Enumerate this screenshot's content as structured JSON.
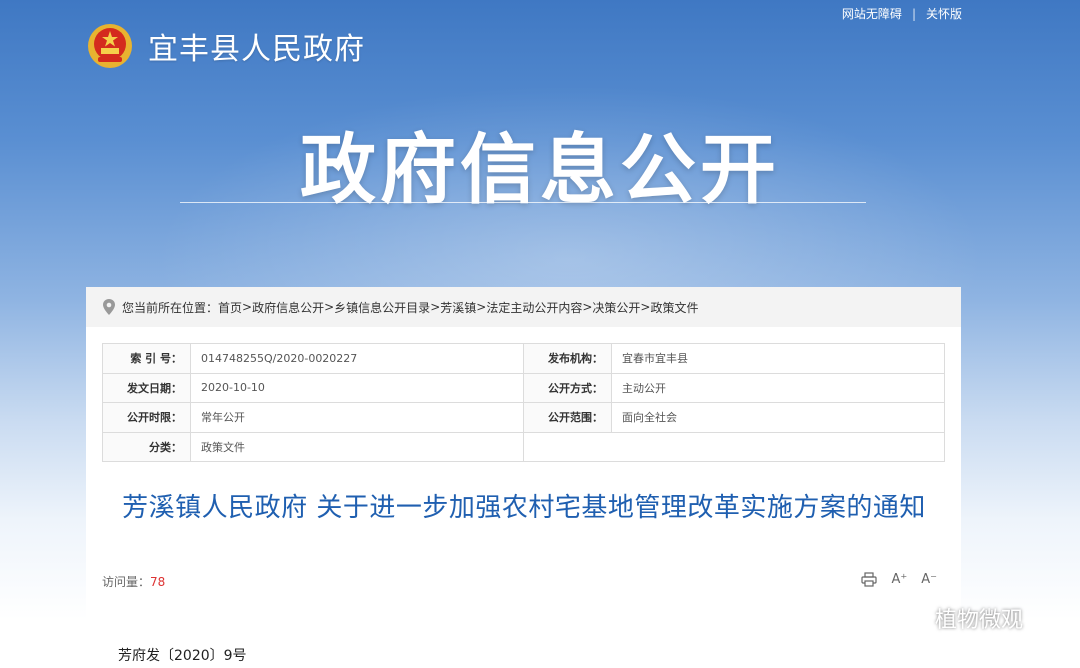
{
  "topbar": {
    "accessibility": "网站无障碍",
    "care": "关怀版",
    "separator": "|"
  },
  "site": {
    "title": "宜丰县人民政府"
  },
  "hero": {
    "title": "政府信息公开"
  },
  "breadcrumb": {
    "prefix": "您当前所在位置：",
    "items": [
      "首页",
      "政府信息公开",
      "乡镇信息公开目录",
      "芳溪镇",
      "法定主动公开内容",
      "决策公开",
      "政策文件"
    ],
    "separator": ">"
  },
  "meta": {
    "index_label": "索 引 号：",
    "index_value": "014748255Q/2020-0020227",
    "org_label": "发布机构：",
    "org_value": "宜春市宜丰县",
    "date_label": "发文日期：",
    "date_value": "2020-10-10",
    "mode_label": "公开方式：",
    "mode_value": "主动公开",
    "period_label": "公开时限：",
    "period_value": "常年公开",
    "scope_label": "公开范围：",
    "scope_value": "面向全社会",
    "category_label": "分类：",
    "category_value": "政策文件"
  },
  "document": {
    "title": "芳溪镇人民政府 关于进一步加强农村宅基地管理改革实施方案的通知",
    "views_label": "访问量：",
    "views": "78",
    "doc_number": "芳府发〔2020〕9号"
  },
  "tools": {
    "font_up": "A⁺",
    "font_down": "A⁻",
    "print_icon": "printer-icon"
  },
  "watermark": {
    "text": "植物微观"
  },
  "colors": {
    "accent": "#1f5fb0",
    "hero_top": "#3f78c3",
    "views_number": "#dd3333"
  }
}
